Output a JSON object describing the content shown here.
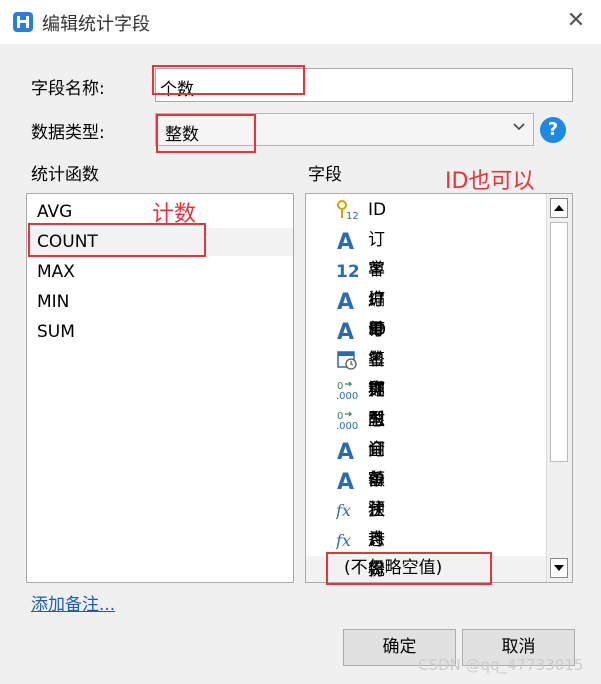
{
  "window": {
    "title": "编辑统计字段",
    "close_glyph": "✕"
  },
  "form": {
    "name_label": "字段名称:",
    "name_value": "个数",
    "type_label": "数据类型:",
    "type_value": "整数",
    "help_glyph": "?"
  },
  "functions": {
    "header": "统计函数",
    "items": [
      "AVG",
      "COUNT",
      "MAX",
      "MIN",
      "SUM"
    ],
    "selected": "COUNT"
  },
  "fields": {
    "header": "字段",
    "items": [
      {
        "label": "ID",
        "icon": "key-number-icon"
      },
      {
        "label": "订单编号",
        "icon": "text-a-icon"
      },
      {
        "label": "客户ID",
        "icon": "number-12-icon"
      },
      {
        "label": "订单名称",
        "icon": "text-a-icon"
      },
      {
        "label": "订单类型",
        "icon": "text-a-icon"
      },
      {
        "label": "签订时间",
        "icon": "calendar-icon"
      },
      {
        "label": "期限",
        "icon": "decimal-icon"
      },
      {
        "label": "总金额",
        "icon": "decimal-icon"
      },
      {
        "label": "订单状态",
        "icon": "text-a-icon"
      },
      {
        "label": "备注",
        "icon": "text-a-icon"
      },
      {
        "label": "预计完成时间",
        "icon": "fx-icon"
      },
      {
        "label": "月份",
        "icon": "fx-icon"
      },
      {
        "label": "(不忽略空值)",
        "icon": ""
      }
    ]
  },
  "annotations": {
    "count_note": "计数",
    "id_note": "ID也可以"
  },
  "footer": {
    "add_note_link": "添加备注...",
    "ok_button": "确定",
    "cancel_button": "取消",
    "watermark": "CSDN @qq_47733015"
  },
  "colors": {
    "accent": "#2b7fd6",
    "annotation": "#e8333a",
    "help": "#1e88e5"
  }
}
